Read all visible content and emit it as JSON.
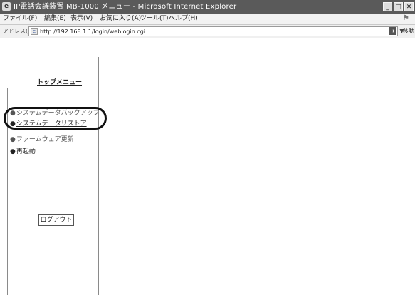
{
  "window": {
    "title": "IP電話会議装置 MB-1000 メニュー - Microsoft Internet Explorer",
    "app_icon": "ie-icon"
  },
  "menubar": {
    "items": [
      "ファイル(F)",
      "編集(E)",
      "表示(V)",
      "お気に入り(A)",
      "ツール(T)",
      "ヘルプ(H)"
    ]
  },
  "address": {
    "label": "アドレス(D)",
    "url": "http://192.168.1.1/login/weblogin.cgi",
    "go_label": "移動"
  },
  "sidebar": {
    "title": "トップメニュー",
    "items": [
      {
        "label": "システムデータバックアップ",
        "icon": "bullet-icon"
      },
      {
        "label": "システムデータリストア",
        "icon": "bullet-icon"
      },
      {
        "label": "ファームウェア更新",
        "icon": "bullet-icon"
      },
      {
        "label": "再起動",
        "icon": "bullet-icon"
      }
    ],
    "logout_label": "ログアウト"
  }
}
